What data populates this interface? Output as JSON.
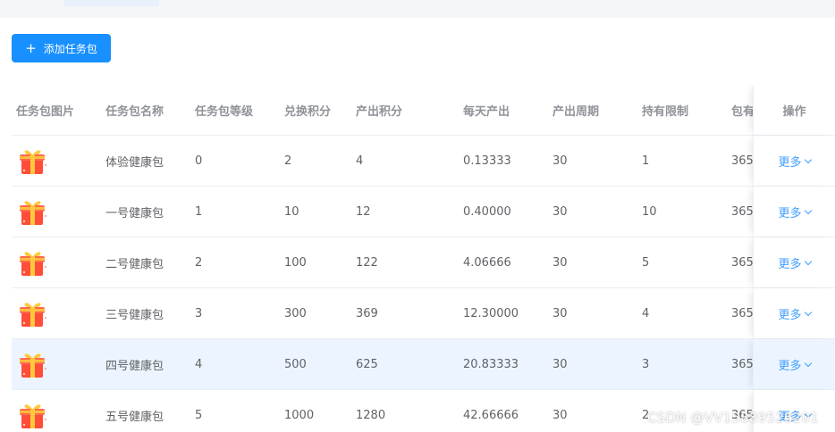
{
  "toolbar": {
    "add_label": "添加任务包",
    "add_icon": "plus-icon"
  },
  "table": {
    "columns": [
      "任务包图片",
      "任务包名称",
      "任务包等级",
      "兑换积分",
      "产出积分",
      "每天产出",
      "产出周期",
      "持有限制",
      "包有",
      "操作"
    ],
    "rows": [
      {
        "name": "体验健康包",
        "level": "0",
        "exchange": "2",
        "output": "4",
        "daily": "0.13333",
        "cycle": "30",
        "limit": "1",
        "extra": "365",
        "action": "更多"
      },
      {
        "name": "一号健康包",
        "level": "1",
        "exchange": "10",
        "output": "12",
        "daily": "0.40000",
        "cycle": "30",
        "limit": "10",
        "extra": "365",
        "action": "更多"
      },
      {
        "name": "二号健康包",
        "level": "2",
        "exchange": "100",
        "output": "122",
        "daily": "4.06666",
        "cycle": "30",
        "limit": "5",
        "extra": "365",
        "action": "更多"
      },
      {
        "name": "三号健康包",
        "level": "3",
        "exchange": "300",
        "output": "369",
        "daily": "12.30000",
        "cycle": "30",
        "limit": "4",
        "extra": "365",
        "action": "更多"
      },
      {
        "name": "四号健康包",
        "level": "4",
        "exchange": "500",
        "output": "625",
        "daily": "20.83333",
        "cycle": "30",
        "limit": "3",
        "extra": "365",
        "action": "更多"
      },
      {
        "name": "五号健康包",
        "level": "5",
        "exchange": "1000",
        "output": "1280",
        "daily": "42.66666",
        "cycle": "30",
        "limit": "2",
        "extra": "365",
        "action": "更多"
      }
    ],
    "highlight_row": 4
  },
  "watermark": "CSDN @VV15889526201",
  "colors": {
    "primary": "#1890ff",
    "link": "#409eff",
    "highlight": "#ecf5ff"
  }
}
